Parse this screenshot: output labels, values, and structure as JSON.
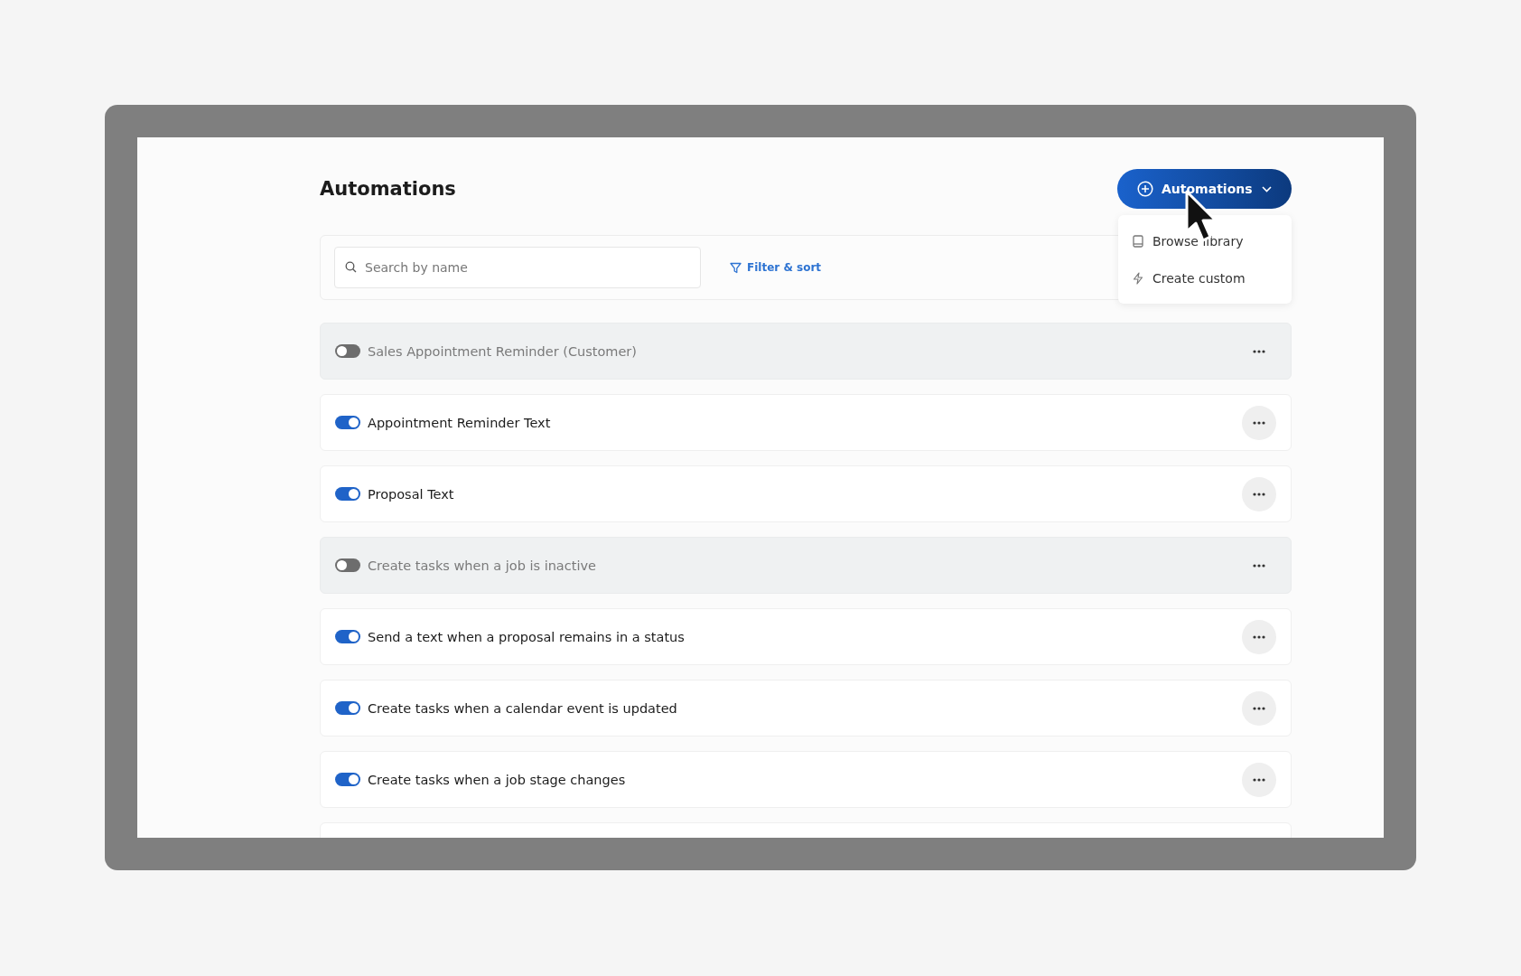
{
  "title": "Automations",
  "add_button": {
    "label": "Automations"
  },
  "add_menu": {
    "items": [
      {
        "label": "Browse library",
        "kind": "library"
      },
      {
        "label": "Create custom",
        "kind": "custom"
      }
    ]
  },
  "search": {
    "placeholder": "Search by name"
  },
  "filter_button": {
    "label": "Filter & sort"
  },
  "automations": [
    {
      "name": "Sales Appointment Reminder (Customer)",
      "on": false
    },
    {
      "name": "Appointment Reminder Text",
      "on": true
    },
    {
      "name": "Proposal Text",
      "on": true
    },
    {
      "name": "Create tasks when a job is inactive",
      "on": false
    },
    {
      "name": "Send a text when a proposal remains in a status",
      "on": true
    },
    {
      "name": "Create tasks when a calendar event is updated",
      "on": true
    },
    {
      "name": "Create tasks when a job stage changes",
      "on": true
    }
  ]
}
